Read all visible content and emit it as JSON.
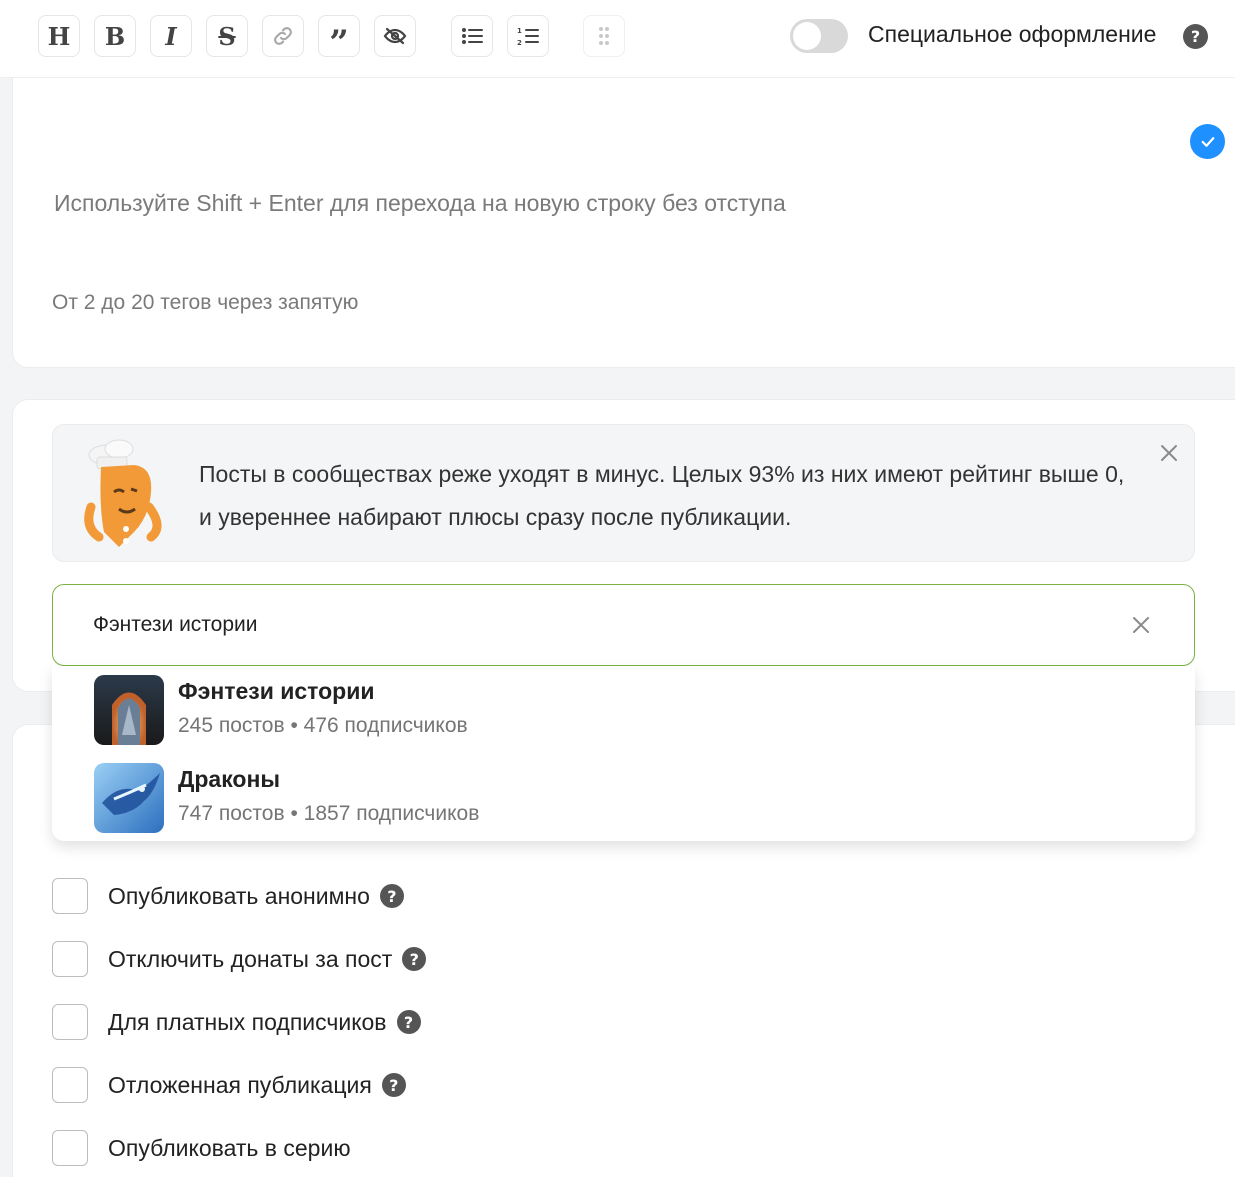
{
  "toolbar": {
    "buttons": [
      {
        "name": "heading-button",
        "glyph": "H"
      },
      {
        "name": "bold-button",
        "glyph": "B"
      },
      {
        "name": "italic-button",
        "glyph": "I"
      },
      {
        "name": "strikethrough-button",
        "glyph": "S"
      },
      {
        "name": "link-button",
        "icon": "link-icon"
      },
      {
        "name": "quote-button",
        "glyph": "”"
      },
      {
        "name": "spoiler-button",
        "icon": "eye-slash-icon"
      },
      {
        "name": "bullet-list-button",
        "icon": "bullet-list-icon"
      },
      {
        "name": "numbered-list-button",
        "icon": "numbered-list-icon"
      },
      {
        "name": "drag-handle-button",
        "icon": "grip-dots-icon"
      }
    ],
    "special_label": "Специальное оформление",
    "special_enabled": false
  },
  "editor": {
    "hint": "Используйте Shift + Enter для перехода на новую строку без отступа",
    "tags_placeholder": "От 2 до 20 тегов через запятую",
    "status_icon": "check-circle-icon"
  },
  "banner": {
    "text": "Посты в сообществах реже уходят в минус. Целых 93% из них имеют рейтинг выше 0, и увереннее набирают плюсы сразу после публикации.",
    "close_icon": "close-icon"
  },
  "search": {
    "value": "Фэнтези истории"
  },
  "dropdown": {
    "items": [
      {
        "title": "Фэнтези истории",
        "meta": "245 постов • 476 подписчиков"
      },
      {
        "title": "Драконы",
        "meta": "747 постов • 1857 подписчиков"
      }
    ]
  },
  "options": [
    {
      "label": "Опубликовать анонимно",
      "help": true
    },
    {
      "label": "Отключить донаты за пост",
      "help": true
    },
    {
      "label": "Для платных подписчиков",
      "help": true
    },
    {
      "label": "Отложенная публикация",
      "help": true
    },
    {
      "label": "Опубликовать в серию",
      "help": false
    }
  ],
  "colors": {
    "accent_blue": "#1e90ff",
    "search_border": "#7cb342"
  }
}
